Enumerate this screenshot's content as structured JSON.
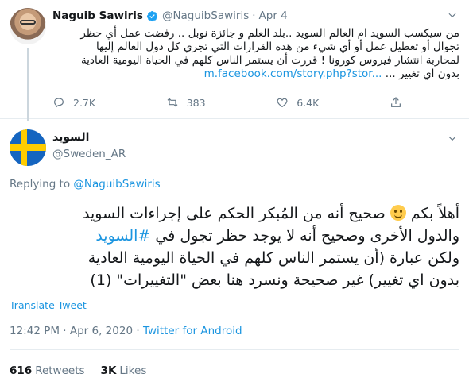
{
  "tweet1": {
    "name": "Naguib Sawiris",
    "handle": "@NaguibSawiris",
    "separator": "·",
    "date": "Apr 4",
    "text_lines": [
      "من سيكسب السويد ام العالم السويد ..بلد العلم و جائزة نوبل .. رفضت عمل أي حظر",
      "تجوال أو تعطيل عمل أو أي شيء من هذه القرارات التي تجري كل دول العالم إليها",
      "لمحاربة انتشار فيروس كورونا ! قررت أن يستمر الناس كلهم في الحياة اليومية العادية"
    ],
    "last_line_text": "بدون اي تغيير ...",
    "link": "m.facebook.com/story.php?stor...",
    "replies": "",
    "retweets": "383",
    "likes": "6.4K",
    "reply_count": "2.7K"
  },
  "tweet2": {
    "name": "السويد",
    "handle": "@Sweden_AR",
    "replying_prefix": "Replying to",
    "replying_to": "@NaguibSawiris",
    "line1_a": "أهلاً بكم",
    "line1_b": "صحيح أنه من المُبكر الحكم على إجراءات السويد",
    "line2_a": "والدول الأخرى وصحيح أنه لا يوجد حظر تجول في",
    "hashtag": "#السويد",
    "line3": "ولكن عبارة (أن يستمر الناس كلهم في الحياة اليومية العادية",
    "line4": "بدون اي تغيير) غير صحيحة ونسرد هنا بعض \"التغييرات\" (1)",
    "translate": "Translate Tweet",
    "time": "12:42 PM · Apr 6, 2020",
    "meta_separator": "·",
    "client": "Twitter for Android",
    "retweets_count": "616",
    "retweets_label": "Retweets",
    "likes_count": "3K",
    "likes_label": "Likes"
  },
  "colors": {
    "link": "#1b95e0",
    "muted": "#657786",
    "text": "#14171a",
    "divider": "#e6ecf0",
    "sweden_blue": "#1565c0",
    "sweden_yellow": "#ffcc00"
  },
  "icons": [
    "verified-badge-icon",
    "chevron-down-icon",
    "reply-icon",
    "retweet-icon",
    "like-icon",
    "share-icon",
    "smiley-emoji-icon"
  ]
}
